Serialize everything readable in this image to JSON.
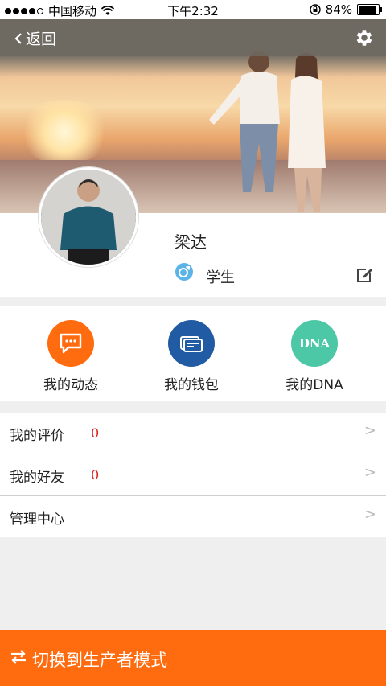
{
  "status_bar": {
    "carrier": "中国移动",
    "time": "下午2:32",
    "battery": "84%",
    "battery_level": 0.84
  },
  "nav": {
    "back_label": "返回"
  },
  "profile": {
    "name": "梁达",
    "role": "学生"
  },
  "quick_actions": [
    {
      "label": "我的动态",
      "icon": "message-icon",
      "color": "#ff6b0f"
    },
    {
      "label": "我的钱包",
      "icon": "wallet-icon",
      "color": "#215ba3"
    },
    {
      "label": "我的DNA",
      "icon": "dna-icon",
      "color": "#4dc8a6",
      "icon_text": "DNA"
    }
  ],
  "menu": [
    {
      "label": "我的评价",
      "count": "0"
    },
    {
      "label": "我的好友",
      "count": "0"
    },
    {
      "label": "管理中心",
      "count": ""
    }
  ],
  "chevron": ">",
  "bottom_button": {
    "label": "切换到生产者模式"
  },
  "colors": {
    "accent": "#ff6b0f",
    "count": "#e02020"
  }
}
